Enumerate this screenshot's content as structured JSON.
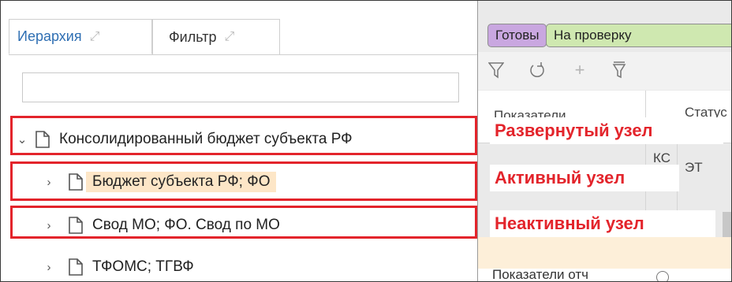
{
  "left_panel": {
    "tabs": [
      {
        "label": "Иерархия",
        "active": true
      },
      {
        "label": "Фильтр",
        "active": false
      }
    ],
    "search": {
      "value": "",
      "placeholder": ""
    },
    "tree": [
      {
        "label": "Консолидированный бюджет субъекта РФ",
        "expanded": true
      },
      {
        "label": "Бюджет субъекта РФ; ФО",
        "expanded": false,
        "highlighted": true
      },
      {
        "label": "Свод МО; ФО. Свод по МО",
        "expanded": false
      },
      {
        "label": "ТФОМС; ТГВФ",
        "expanded": false
      }
    ]
  },
  "right_panel": {
    "status_buttons": [
      {
        "label": "Готовы",
        "color": "#c9a7e0"
      },
      {
        "label": "На проверку",
        "color": "#cfe8b0"
      }
    ],
    "toolbar_icons": [
      "filter-icon",
      "refresh-icon",
      "add-icon",
      "filter-clear-icon"
    ],
    "grid_headers": [
      "Показатели",
      "Статус"
    ],
    "cells": {
      "code_ks": "КС",
      "code_et": "ЭТ"
    },
    "bottom_text": "Показатели отч"
  },
  "annotations": {
    "expanded": "Развернутый узел",
    "active": "Активный узел",
    "inactive": "Неактивный узел"
  },
  "colors": {
    "accent_red": "#e3242b",
    "highlight": "#fde6c7",
    "tab_active": "#2f6fb3"
  }
}
